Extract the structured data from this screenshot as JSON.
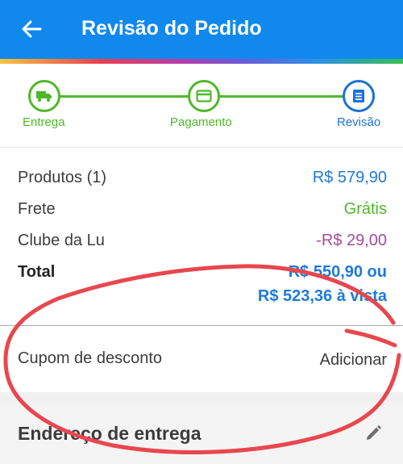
{
  "header": {
    "title": "Revisão do Pedido",
    "back_icon": "arrow-left-icon",
    "background": "#1189ec"
  },
  "stepper": {
    "steps": [
      {
        "label": "Entrega",
        "icon": "truck-icon",
        "state": "done"
      },
      {
        "label": "Pagamento",
        "icon": "card-icon",
        "state": "done"
      },
      {
        "label": "Revisão",
        "icon": "list-icon",
        "state": "current"
      }
    ]
  },
  "summary": {
    "products_label": "Produtos (1)",
    "products_value": "R$ 579,90",
    "shipping_label": "Frete",
    "shipping_value": "Grátis",
    "club_label": "Clube da Lu",
    "club_value": "-R$ 29,00",
    "total_label": "Total",
    "total_value_line1": "R$ 550,90 ou",
    "total_value_line2": "R$ 523,36 à vista"
  },
  "coupon": {
    "label": "Cupom de desconto",
    "action": "Adicionar"
  },
  "address": {
    "title": "Endereço de entrega",
    "edit_icon": "pencil-icon"
  },
  "colors": {
    "accent_blue": "#1f7ad8",
    "success_green": "#4fb82a",
    "club_purple": "#a64b98",
    "annotation_red": "#e8474f"
  }
}
